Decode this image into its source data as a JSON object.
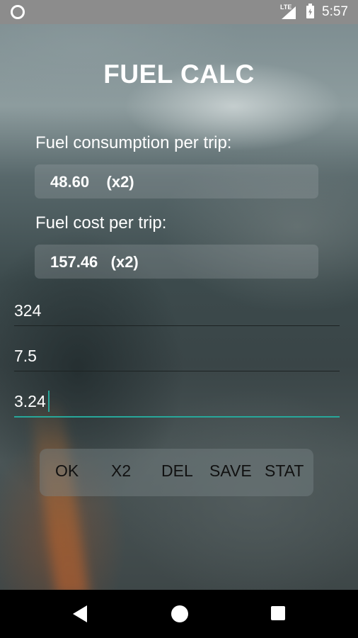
{
  "status_bar": {
    "network_label": "LTE",
    "time": "5:57",
    "icons": [
      "circle-indicator-icon",
      "signal-icon",
      "battery-charging-icon"
    ]
  },
  "app": {
    "title": "FUEL CALC"
  },
  "results": {
    "consumption_label": "Fuel consumption per trip:",
    "consumption_value": "48.60    (x2)",
    "cost_label": "Fuel cost per trip:",
    "cost_value": "157.46   (x2)"
  },
  "inputs": {
    "distance_value": "324",
    "consumption_rate_value": "7.5",
    "price_value": "3.24"
  },
  "buttons": {
    "ok": "OK",
    "x2": "X2",
    "del": "DEL",
    "save": "SAVE",
    "stat": "STAT"
  },
  "colors": {
    "accent": "#27a79a",
    "status_bar": "#8c8c8c",
    "nav_bar": "#000000"
  },
  "nav_bar": {
    "icons": [
      "back-icon",
      "home-icon",
      "recent-apps-icon"
    ]
  }
}
